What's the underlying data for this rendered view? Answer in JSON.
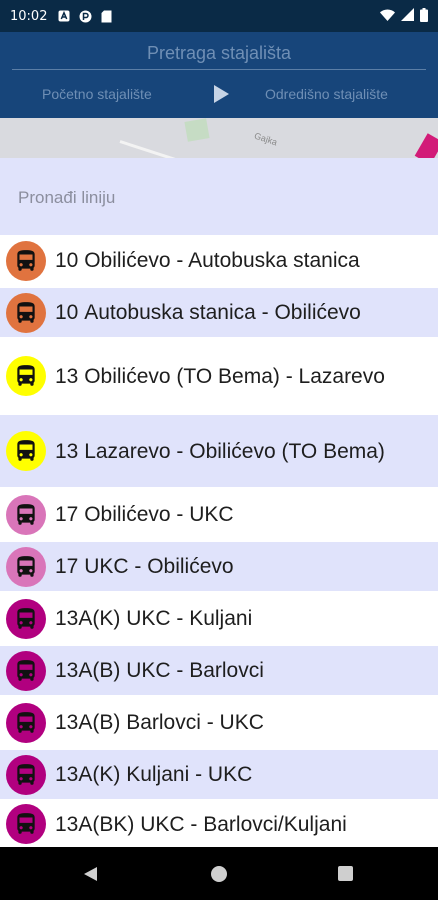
{
  "status_bar": {
    "time": "10:02",
    "icons_left": [
      "notification-a-icon",
      "privacy-icon",
      "sd-card-icon"
    ],
    "icons_right": [
      "wifi-icon",
      "signal-icon",
      "battery-icon"
    ]
  },
  "header": {
    "search_placeholder": "Pretraga stajališta",
    "start_stop_label": "Početno stajalište",
    "destination_stop_label": "Odredišno stajalište"
  },
  "map": {
    "street_label": "Gajka"
  },
  "sheet": {
    "find_line_label": "Pronađi liniju"
  },
  "colors": {
    "status_bar": "#0a2a46",
    "header": "#17457a",
    "sheet_background": "#e0e3fb",
    "line_10": "#e0733f",
    "line_13": "#ffff00",
    "line_17": "#d975b9",
    "line_13a": "#b1007f"
  },
  "lines": [
    {
      "number": "10",
      "name": "Obilićevo - Autobuska stanica",
      "color": "#e0733f",
      "icon": "bus-icon"
    },
    {
      "number": "10",
      "name": "Autobuska stanica - Obilićevo",
      "color": "#e0733f",
      "icon": "bus-icon"
    },
    {
      "number": "13",
      "name": "Obilićevo (TO Bema) - Lazarevo",
      "color": "#ffff00",
      "icon": "bus-icon"
    },
    {
      "number": "13",
      "name": "Lazarevo - Obilićevo (TO Bema)",
      "color": "#ffff00",
      "icon": "bus-icon"
    },
    {
      "number": "17",
      "name": "Obilićevo - UKC",
      "color": "#d975b9",
      "icon": "bus-icon"
    },
    {
      "number": "17",
      "name": "UKC - Obilićevo",
      "color": "#d975b9",
      "icon": "bus-icon"
    },
    {
      "number": "13A(K)",
      "name": "UKC - Kuljani",
      "color": "#b1007f",
      "icon": "bus-icon"
    },
    {
      "number": "13A(B)",
      "name": "UKC - Barlovci",
      "color": "#b1007f",
      "icon": "bus-icon"
    },
    {
      "number": "13A(B)",
      "name": "Barlovci - UKC",
      "color": "#b1007f",
      "icon": "bus-icon"
    },
    {
      "number": "13A(K)",
      "name": "Kuljani - UKC",
      "color": "#b1007f",
      "icon": "bus-icon"
    },
    {
      "number": "13A(BK)",
      "name": "UKC - Barlovci/Kuljani",
      "color": "#b1007f",
      "icon": "bus-icon"
    }
  ],
  "nav_bar": {
    "icons": [
      "back-icon",
      "home-icon",
      "recents-icon"
    ]
  }
}
